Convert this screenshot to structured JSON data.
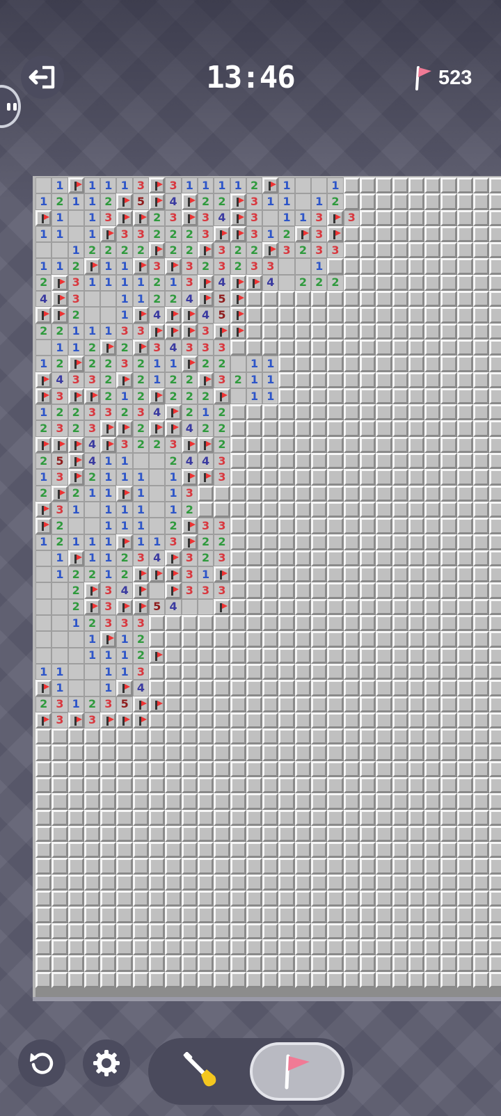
{
  "header": {
    "timer": "13:46",
    "flag_count": "523",
    "exit_icon": "exit-icon",
    "flag_icon": "flag-icon"
  },
  "board": {
    "columns": 29,
    "rows": 50,
    "revealed_rows": [
      ".,1,F,1,1,1,3,F,3,1,1,1,1,2,F,1,.,.,1",
      "1,2,1,1,2,F,5,F,4,F,2,2,F,3,1,1,.,1,2",
      "F,1,.,1,3,F,F,2,3,F,3,4,F,3,.,1,1,3,F,3",
      "1,1,.,1,F,3,3,2,2,2,3,F,F,3,1,2,F,3,F",
      ".,.,1,2,2,2,2,F,2,2,F,3,2,2,F,3,2,3,3",
      "1,1,2,F,1,1,F,3,F,3,2,3,2,3,3,.,.,1",
      "2,F,3,1,1,1,1,2,1,3,F,4,F,F,4,.,2,2,2",
      "4,F,3,.,.,1,1,2,2,4,F,5,F",
      "F,F,2,.,.,1,F,4,F,F,4,5,F",
      "2,2,1,1,1,3,3,F,F,F,3,F,F",
      ".,1,1,2,F,2,F,3,4,3,3,3",
      "1,2,F,2,2,3,2,1,1,F,2,2,.,1,1",
      "F,4,3,3,2,F,2,1,2,2,F,3,2,1,1",
      "F,3,F,F,2,1,2,F,2,2,2,F,.,1,1",
      "1,2,2,3,3,2,3,4,F,2,1,2",
      "2,3,2,3,F,F,2,F,F,4,2,2",
      "F,F,F,4,F,3,2,2,3,F,F,2",
      "2,5,F,4,1,1,.,.,2,4,4,3",
      "1,3,F,2,1,1,1,.,1,F,F,3",
      "2,F,2,1,1,F,1,.,1,3",
      "F,3,1,.,1,1,1,.,1,2",
      "F,2,.,.,1,1,1,.,2,F,3,3",
      "1,2,1,1,1,F,1,1,3,F,2,2",
      ".,1,F,1,1,2,3,4,F,3,2,3",
      ".,1,2,2,1,2,F,F,F,3,1,F",
      ".,.,2,F,3,4,F,.,F,3,3,3",
      ".,.,2,F,3,F,F,5,4,.,.,F",
      ".,.,1,2,3,3,3",
      ".,.,.,1,F,1,2",
      ".,.,.,1,1,1,2,F",
      "1,1,.,.,1,1,3",
      "F,1,.,.,1,F,4",
      "2,3,1,2,3,5,F,F",
      "F,3,F,3,F,F,F"
    ]
  },
  "bottom": {
    "restart_icon": "restart-icon",
    "settings_icon": "gear-icon",
    "dig_mode_icon": "shovel-icon",
    "flag_mode_icon": "flag-icon",
    "active_mode": "flag"
  }
}
